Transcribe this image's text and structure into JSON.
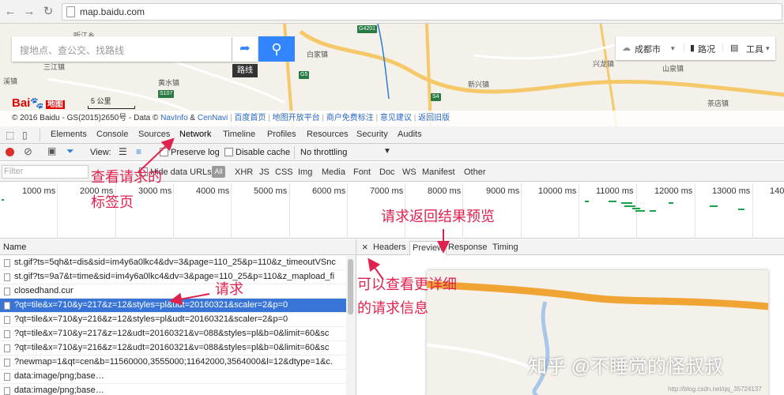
{
  "browser": {
    "url": "map.baidu.com"
  },
  "map": {
    "search_placeholder": "搜地点、查公交、找路线",
    "route_tooltip": "路线",
    "city": "成都市",
    "traffic": "路况",
    "tools": "工具",
    "logo_text": "Bai",
    "logo_map": "地图",
    "scale": "5 公里",
    "labels": [
      "听江乡",
      "白家镇",
      "三江镇",
      "黄水镇",
      "新兴镇",
      "兴龙镇",
      "山泉镇",
      "茶店镇",
      "溪镇"
    ],
    "shields": [
      "G4201",
      "G5",
      "S107",
      "S4"
    ],
    "copyright": "© 2016 Baidu - GS(2015)2650号 - Data ©",
    "navinfo": "NavInfo",
    "and": "&",
    "cennavi": "CenNavi",
    "links": [
      "百度首页",
      "地图开放平台",
      "商户免费标注",
      "意见建议",
      "返回旧版"
    ]
  },
  "devtools": {
    "tabs": [
      "Elements",
      "Console",
      "Sources",
      "Network",
      "Timeline",
      "Profiles",
      "Resources",
      "Security",
      "Audits"
    ],
    "active_tab": "Network",
    "view_label": "View:",
    "preserve_log": "Preserve log",
    "disable_cache": "Disable cache",
    "throttling": "No throttling",
    "filter_placeholder": "Filter",
    "hide_data_urls": "Hide data URLs",
    "all": "All",
    "types": [
      "XHR",
      "JS",
      "CSS",
      "Img",
      "Media",
      "Font",
      "Doc",
      "WS",
      "Manifest",
      "Other"
    ],
    "ticks": [
      "1000 ms",
      "2000 ms",
      "3000 ms",
      "4000 ms",
      "5000 ms",
      "6000 ms",
      "7000 ms",
      "8000 ms",
      "9000 ms",
      "10000 ms",
      "11000 ms",
      "12000 ms",
      "13000 ms",
      "140"
    ],
    "name_header": "Name",
    "rows": [
      "st.gif?ts=5qh&t=dis&sid=im4y6a0lkc4&dv=3&page=110_25&p=110&z_timeoutVSnc",
      "st.gif?ts=9a7&t=time&sid=im4y6a0lkc4&dv=3&page=110_25&p=110&z_mapload_fi",
      "closedhand.cur",
      "?qt=tile&x=710&y=217&z=12&styles=pl&udt=20160321&scaler=2&p=0",
      "?qt=tile&x=710&y=216&z=12&styles=pl&udt=20160321&scaler=2&p=0",
      "?qt=tile&x=710&y=217&z=12&udt=20160321&v=088&styles=pl&b=0&limit=60&sc",
      "?qt=tile&x=710&y=216&z=12&udt=20160321&v=088&styles=pl&b=0&limit=60&sc",
      "?newmap=1&qt=cen&b=11560000,3555000;11642000,3564000&l=12&dtype=1&c.",
      "data:image/png;base…",
      "data:image/png;base…"
    ],
    "selected_row": 3,
    "detail_tabs": [
      "Headers",
      "Preview",
      "Response",
      "Timing"
    ],
    "active_detail_tab": "Preview",
    "close": "×"
  },
  "annotations": {
    "tab_note_1": "查看请求的",
    "tab_note_2": "标签页",
    "request": "请求",
    "preview_note": "请求返回结果预览",
    "detail_note_1": "可以查看更详细",
    "detail_note_2": "的请求信息"
  },
  "watermark": "知乎 @不睡觉的怪叔叔",
  "watermark_small": "http://blog.csdn.net/qq_35724137",
  "colors": {
    "accent": "#3385ff",
    "annotation": "#e0224f",
    "selection": "#3875d7",
    "record": "#d9302c"
  }
}
